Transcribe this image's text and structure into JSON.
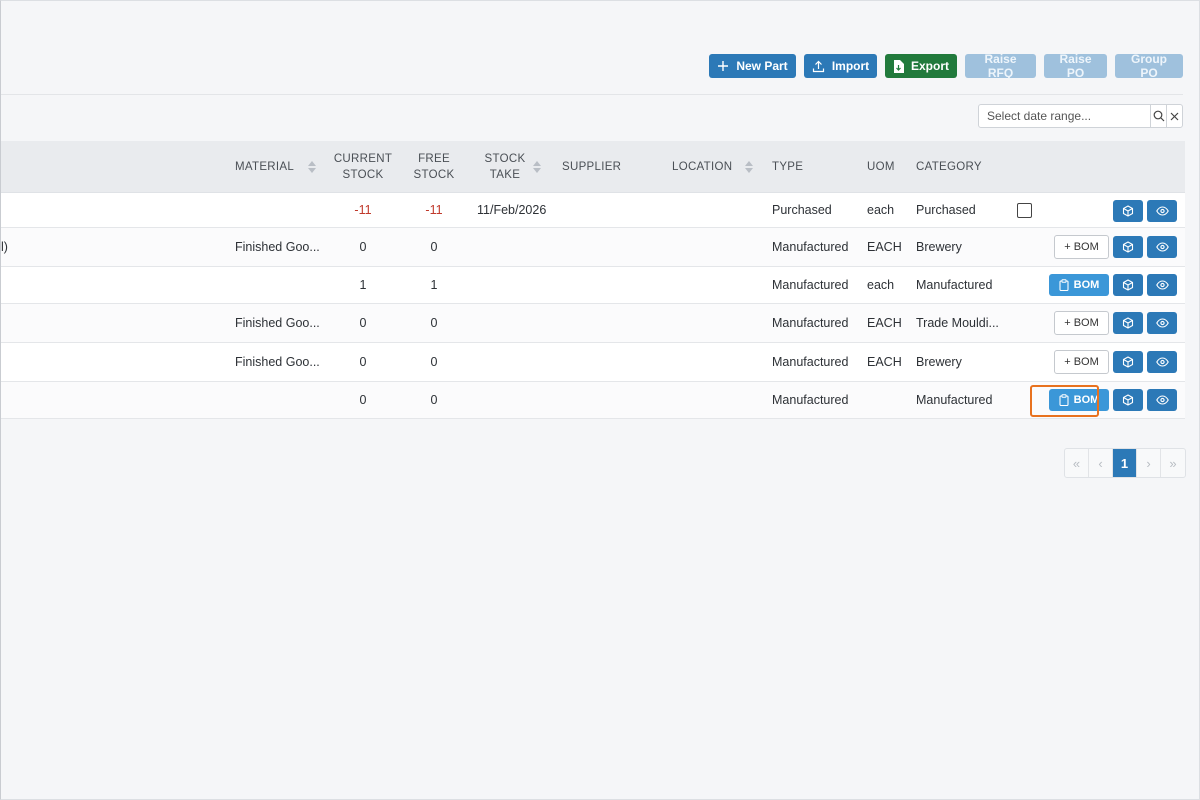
{
  "toolbar": {
    "new_part": "New Part",
    "import": "Import",
    "export": "Export",
    "raise_rfq": "Raise RFQ",
    "raise_po": "Raise PO",
    "group_po": "Group PO"
  },
  "daterange": {
    "placeholder": "Select date range..."
  },
  "columns": {
    "material": "MATERIAL",
    "current_stock_1": "CURRENT",
    "current_stock_2": "STOCK",
    "free_stock_1": "FREE",
    "free_stock_2": "STOCK",
    "stock_take_1": "STOCK",
    "stock_take_2": "TAKE",
    "supplier": "SUPPLIER",
    "location": "LOCATION",
    "type": "TYPE",
    "uom": "UOM",
    "category": "CATEGORY"
  },
  "rows": [
    {
      "left": "",
      "material": "",
      "current": "-11",
      "free": "-11",
      "stock_take": "11/Feb/2026",
      "type": "Purchased",
      "uom": "each",
      "category": "Purchased",
      "bom": ""
    },
    {
      "left": "l)",
      "material": "Finished Goo...",
      "current": "0",
      "free": "0",
      "stock_take": "",
      "type": "Manufactured",
      "uom": "EACH",
      "category": "Brewery",
      "bom": "+ BOM"
    },
    {
      "left": "",
      "material": "",
      "current": "1",
      "free": "1",
      "stock_take": "",
      "type": "Manufactured",
      "uom": "each",
      "category": "Manufactured",
      "bom": "BOM"
    },
    {
      "left": "",
      "material": "Finished Goo...",
      "current": "0",
      "free": "0",
      "stock_take": "",
      "type": "Manufactured",
      "uom": "EACH",
      "category": "Trade Mouldi...",
      "bom": "+ BOM"
    },
    {
      "left": "",
      "material": "Finished Goo...",
      "current": "0",
      "free": "0",
      "stock_take": "",
      "type": "Manufactured",
      "uom": "EACH",
      "category": "Brewery",
      "bom": "+ BOM"
    },
    {
      "left": "",
      "material": "",
      "current": "0",
      "free": "0",
      "stock_take": "",
      "type": "Manufactured",
      "uom": "",
      "category": "Manufactured",
      "bom": "BOM"
    }
  ],
  "pagination": {
    "first": "«",
    "prev": "‹",
    "current": "1",
    "next": "›",
    "last": "»"
  },
  "icons": {
    "plus": "plus-icon",
    "upload": "upload-icon",
    "file_export": "file-export-icon",
    "search": "search-icon",
    "close": "close-icon",
    "clipboard": "clipboard-icon",
    "cube": "cube-icon",
    "eye": "eye-icon"
  },
  "colors": {
    "primary": "#2c79b7",
    "export": "#217a3c",
    "bom": "#3b97d8",
    "negative": "#c0392b",
    "highlight": "#e8721f"
  }
}
